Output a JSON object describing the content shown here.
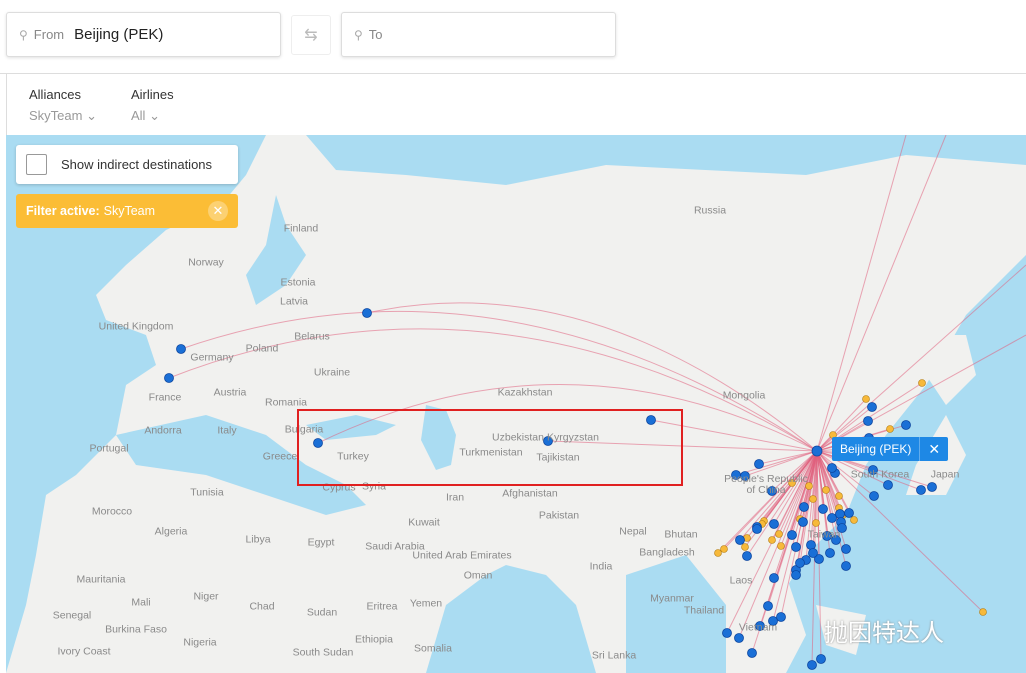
{
  "search": {
    "from_label": "From",
    "from_value": "Beijing (PEK)",
    "to_placeholder": "To",
    "swap_icon": "swap-arrows-icon",
    "pin_icon": "location-pin-icon"
  },
  "filters": {
    "alliances_label": "Alliances",
    "alliances_value": "SkyTeam",
    "airlines_label": "Airlines",
    "airlines_value": "All"
  },
  "map": {
    "indirect_label": "Show indirect destinations",
    "filter_active_label": "Filter active:",
    "filter_active_value": "SkyTeam",
    "origin_tag": "Beijing (PEK)",
    "watermark": "抛因特达人",
    "colors": {
      "water": "#aadcf2",
      "land": "#f1f1ef",
      "route": "#e0607e",
      "direct": "#1a6fd6",
      "partner": "#f7b93a",
      "filter": "#fbbd36",
      "tag": "#1e88e5"
    },
    "labels": [
      "Russia",
      "Finland",
      "Norway",
      "Estonia",
      "Latvia",
      "United Kingdom",
      "Germany",
      "Poland",
      "Belarus",
      "Ukraine",
      "France",
      "Austria",
      "Romania",
      "Andorra",
      "Italy",
      "Portugal",
      "Bulgaria",
      "Greece",
      "Turkey",
      "Cyprus",
      "Syria",
      "Kazakhstan",
      "Mongolia",
      "Uzbekistan",
      "Kyrgyzstan",
      "Turkmenistan",
      "Tajikistan",
      "Iran",
      "Afghanistan",
      "Pakistan",
      "Tunisia",
      "Morocco",
      "Algeria",
      "Libya",
      "Egypt",
      "Saudi Arabia",
      "Kuwait",
      "United Arab Emirates",
      "Oman",
      "Yemen",
      "Nepal",
      "Bhutan",
      "Bangladesh",
      "India",
      "Myanmar",
      "Thailand",
      "Laos",
      "Vietnam",
      "Sri Lanka",
      "Mauritania",
      "Mali",
      "Niger",
      "Chad",
      "Sudan",
      "Senegal",
      "Burkina Faso",
      "Nigeria",
      "Ivory Coast",
      "South Sudan",
      "Ethiopia",
      "Eritrea",
      "Somalia",
      "People's Republic of China",
      "South Korea",
      "Japan",
      "Taiwan"
    ]
  }
}
